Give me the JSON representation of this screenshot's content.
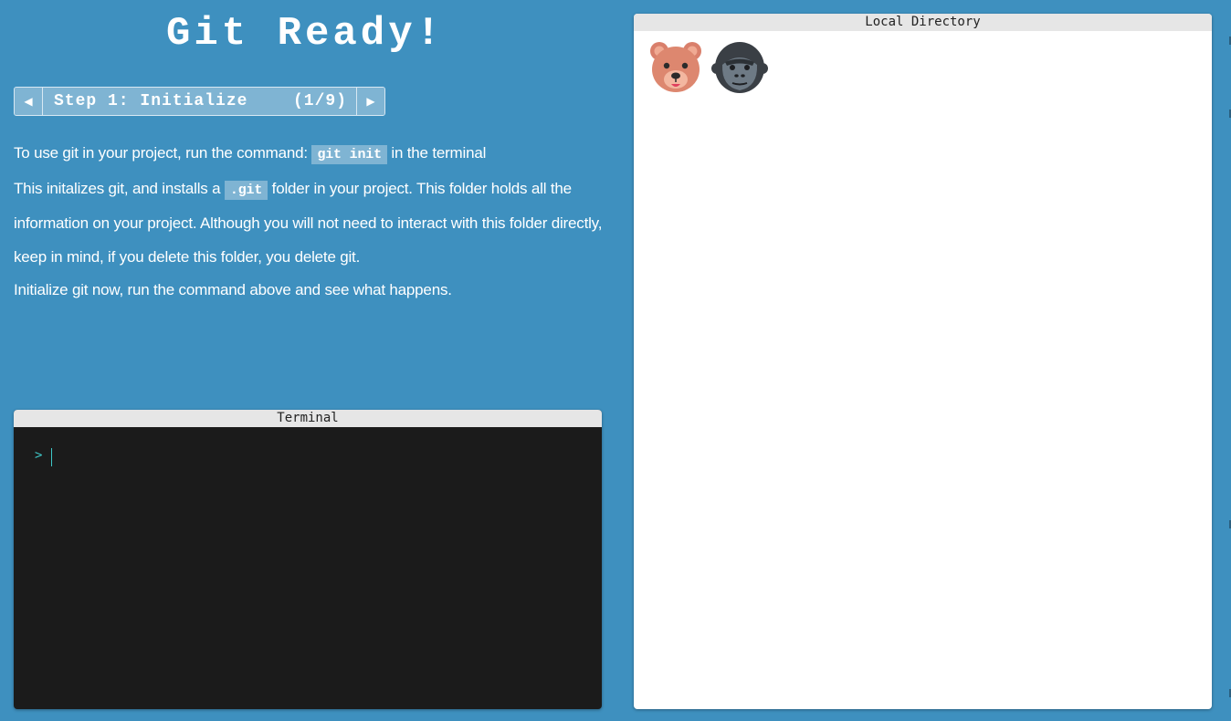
{
  "app": {
    "title": "Git Ready!"
  },
  "stepper": {
    "prev_icon": "◀",
    "label": "Step 1: Initialize",
    "progress": "(1/9)",
    "next_icon": "▶"
  },
  "lesson": {
    "p1_before": "To use git in your project, run the command:",
    "p1_code": "git init",
    "p1_after": "in the terminal",
    "p2_before": "This initalizes git, and installs a",
    "p2_code": ".git",
    "p2_after": "folder in your project. This folder holds all the information on your project. Although you will not need to interact with this folder directly, keep in mind, if you delete this folder, you delete git.",
    "p3": "Initialize git now, run the command above and see what happens."
  },
  "terminal": {
    "title": "Terminal",
    "prompt": ">"
  },
  "local_directory": {
    "title": "Local Directory",
    "items": [
      {
        "icon": "bear-face-icon"
      },
      {
        "icon": "gorilla-icon"
      }
    ]
  },
  "colors": {
    "background": "#3e90bf",
    "accent": "#7fb4d3",
    "terminal_bg": "#1b1b1b",
    "prompt": "#3ec7c7"
  }
}
